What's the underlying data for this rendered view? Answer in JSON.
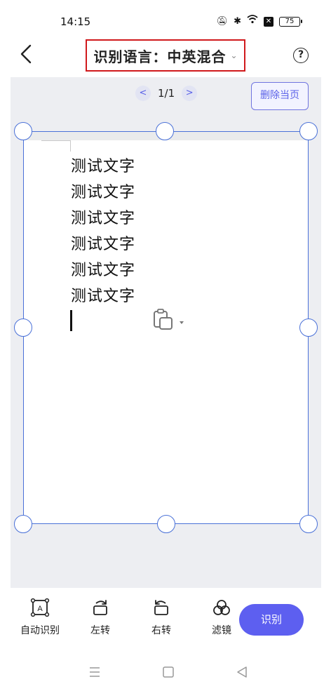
{
  "status_bar": {
    "time": "14:15",
    "icons": [
      "mute-icon",
      "bluetooth-icon",
      "wifi-icon",
      "x-icon"
    ],
    "battery": "75"
  },
  "header": {
    "title": "识别语言：中英混合",
    "chevron": "⌄",
    "help": "?"
  },
  "pager": {
    "prev": "<",
    "text": "1/1",
    "next": ">"
  },
  "delete_page_label": "删除当页",
  "document": {
    "lines": [
      "测试文字",
      "测试文字",
      "测试文字",
      "测试文字",
      "测试文字",
      "测试文字"
    ]
  },
  "toolbar": {
    "auto_detect": "自动识别",
    "rotate_left": "左转",
    "rotate_right": "右转",
    "filter": "滤镜",
    "recognize": "识别"
  },
  "colors": {
    "accent": "#5d5ff0",
    "frame": "#4a71d8",
    "highlight_border": "#d0191c"
  }
}
